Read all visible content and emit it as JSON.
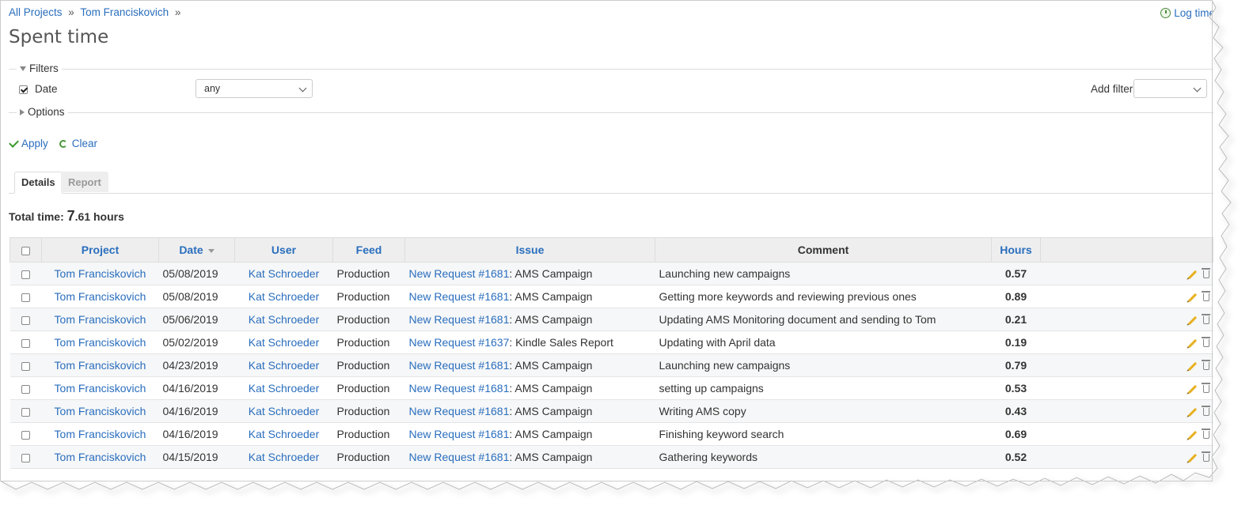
{
  "breadcrumb": {
    "items": [
      "All Projects",
      "Tom Franciskovich"
    ],
    "separator": "»"
  },
  "header": {
    "log_time": "Log time",
    "title": "Spent time"
  },
  "filters": {
    "legend": "Filters",
    "date_label": "Date",
    "date_operator": "any",
    "add_filter_label": "Add filter",
    "add_filter_value": ""
  },
  "options": {
    "legend": "Options"
  },
  "actions": {
    "apply": "Apply",
    "clear": "Clear"
  },
  "tabs": [
    {
      "label": "Details",
      "active": true
    },
    {
      "label": "Report",
      "active": false
    }
  ],
  "total": {
    "label": "Total time:",
    "value_int": "7",
    "value_dec": ".61 hours"
  },
  "table": {
    "columns": [
      "Project",
      "Date",
      "User",
      "Feed",
      "Issue",
      "Comment",
      "Hours"
    ],
    "rows": [
      {
        "project": "Tom Franciskovich",
        "date": "05/08/2019",
        "user": "Kat Schroeder",
        "feed": "Production",
        "issue_link": "New Request #1681",
        "issue_title": ": AMS Campaign",
        "comment": "Launching new campaigns",
        "hours": "0.57"
      },
      {
        "project": "Tom Franciskovich",
        "date": "05/08/2019",
        "user": "Kat Schroeder",
        "feed": "Production",
        "issue_link": "New Request #1681",
        "issue_title": ": AMS Campaign",
        "comment": "Getting more keywords and reviewing previous ones",
        "hours": "0.89"
      },
      {
        "project": "Tom Franciskovich",
        "date": "05/06/2019",
        "user": "Kat Schroeder",
        "feed": "Production",
        "issue_link": "New Request #1681",
        "issue_title": ": AMS Campaign",
        "comment": "Updating AMS Monitoring document and sending to Tom",
        "hours": "0.21"
      },
      {
        "project": "Tom Franciskovich",
        "date": "05/02/2019",
        "user": "Kat Schroeder",
        "feed": "Production",
        "issue_link": "New Request #1637",
        "issue_title": ": Kindle Sales Report",
        "comment": "Updating with April data",
        "hours": "0.19"
      },
      {
        "project": "Tom Franciskovich",
        "date": "04/23/2019",
        "user": "Kat Schroeder",
        "feed": "Production",
        "issue_link": "New Request #1681",
        "issue_title": ": AMS Campaign",
        "comment": "Launching new campaigns",
        "hours": "0.79"
      },
      {
        "project": "Tom Franciskovich",
        "date": "04/16/2019",
        "user": "Kat Schroeder",
        "feed": "Production",
        "issue_link": "New Request #1681",
        "issue_title": ": AMS Campaign",
        "comment": "setting up campaigns",
        "hours": "0.53"
      },
      {
        "project": "Tom Franciskovich",
        "date": "04/16/2019",
        "user": "Kat Schroeder",
        "feed": "Production",
        "issue_link": "New Request #1681",
        "issue_title": ": AMS Campaign",
        "comment": "Writing AMS copy",
        "hours": "0.43"
      },
      {
        "project": "Tom Franciskovich",
        "date": "04/16/2019",
        "user": "Kat Schroeder",
        "feed": "Production",
        "issue_link": "New Request #1681",
        "issue_title": ": AMS Campaign",
        "comment": "Finishing keyword search",
        "hours": "0.69"
      },
      {
        "project": "Tom Franciskovich",
        "date": "04/15/2019",
        "user": "Kat Schroeder",
        "feed": "Production",
        "issue_link": "New Request #1681",
        "issue_title": ": AMS Campaign",
        "comment": "Gathering keywords",
        "hours": "0.52"
      }
    ]
  },
  "icons": {
    "log_time": "clock-add-icon",
    "apply": "checkmark-icon",
    "clear": "reload-icon",
    "edit": "pencil-icon",
    "delete": "trash-icon"
  },
  "colors": {
    "link": "#2a6ebd",
    "header_bg": "#eeeeee",
    "pencil": "#e7b020",
    "apply_check": "#3a9a2a"
  }
}
